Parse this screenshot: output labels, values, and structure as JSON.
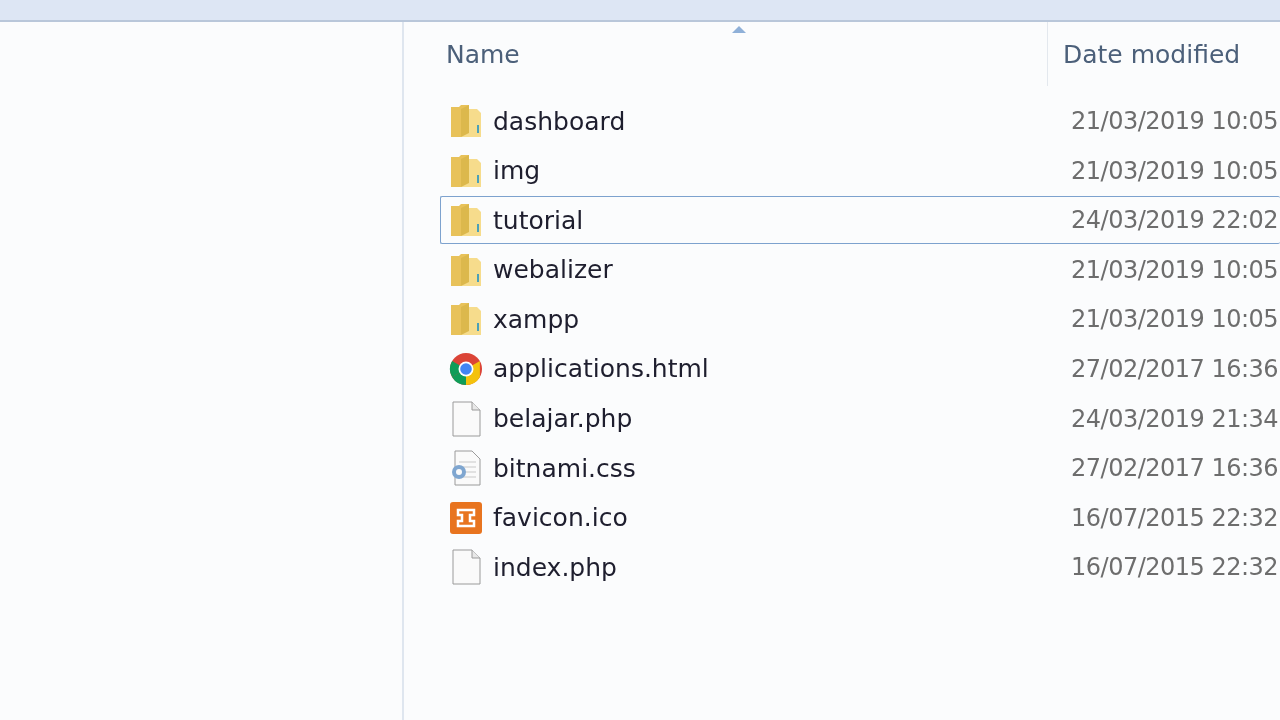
{
  "columns": [
    {
      "label": "Name",
      "sorted": true
    },
    {
      "label": "Date modified",
      "sorted": false
    }
  ],
  "files": [
    {
      "name": "dashboard",
      "date": "21/03/2019 10:05",
      "kind": "folder",
      "selected": false
    },
    {
      "name": "img",
      "date": "21/03/2019 10:05",
      "kind": "folder",
      "selected": false
    },
    {
      "name": "tutorial",
      "date": "24/03/2019 22:02",
      "kind": "folder",
      "selected": true
    },
    {
      "name": "webalizer",
      "date": "21/03/2019 10:05",
      "kind": "folder",
      "selected": false
    },
    {
      "name": "xampp",
      "date": "21/03/2019 10:05",
      "kind": "folder",
      "selected": false
    },
    {
      "name": "applications.html",
      "date": "27/02/2017 16:36",
      "kind": "browser",
      "selected": false
    },
    {
      "name": "belajar.php",
      "date": "24/03/2019 21:34",
      "kind": "file",
      "selected": false
    },
    {
      "name": "bitnami.css",
      "date": "27/02/2017 16:36",
      "kind": "stylesheet",
      "selected": false
    },
    {
      "name": "favicon.ico",
      "date": "16/07/2015 22:32",
      "kind": "xampp",
      "selected": false
    },
    {
      "name": "index.php",
      "date": "16/07/2015 22:32",
      "kind": "file",
      "selected": false
    }
  ]
}
